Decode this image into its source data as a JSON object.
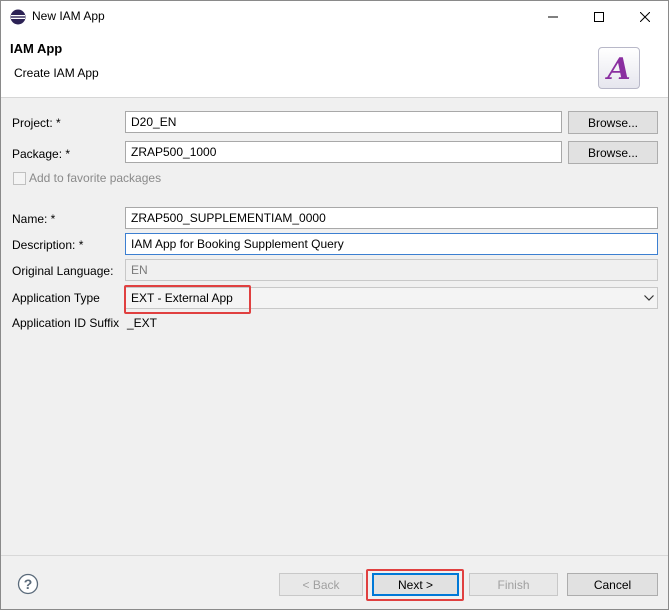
{
  "window": {
    "title": "New IAM App"
  },
  "header": {
    "title": "IAM App",
    "subtitle": "Create IAM App",
    "logo_letter": "A"
  },
  "form": {
    "project": {
      "label": "Project: *",
      "value": "D20_EN",
      "browse": "Browse..."
    },
    "package": {
      "label": "Package: *",
      "value": "ZRAP500_1000",
      "browse": "Browse..."
    },
    "favorite": {
      "label": "Add to favorite packages",
      "checked": false
    },
    "name": {
      "label": "Name: *",
      "value": "ZRAP500_SUPPLEMENTIAM_0000"
    },
    "description": {
      "label": "Description: *",
      "value": "IAM App for Booking Supplement Query"
    },
    "original_language": {
      "label": "Original Language:",
      "value": "EN"
    },
    "application_type": {
      "label": "Application Type",
      "value": "EXT - External App"
    },
    "application_id_suffix": {
      "label": "Application ID Suffix",
      "value": "_EXT"
    }
  },
  "footer": {
    "back": "< Back",
    "next": "Next >",
    "finish": "Finish",
    "cancel": "Cancel",
    "help": "?"
  },
  "colors": {
    "accent": "#0078d7",
    "highlight": "#e04040",
    "logo": "#8a2ea0"
  }
}
